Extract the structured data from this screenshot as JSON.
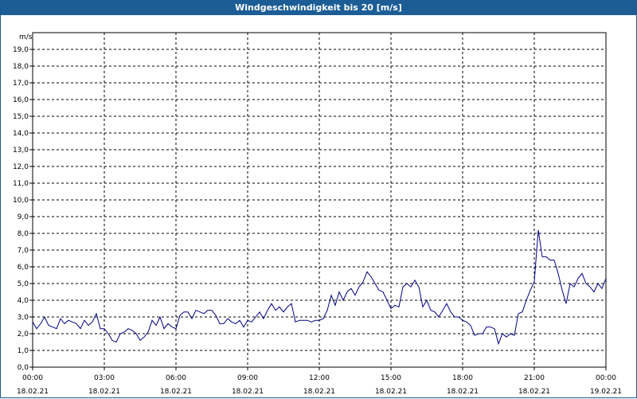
{
  "window": {
    "title": "Windgeschwindigkeit bis 20 [m/s]"
  },
  "chart_data": {
    "type": "line",
    "title": "Windgeschwindigkeit bis 20 [m/s]",
    "ylabel": "m/s",
    "ylim": [
      0,
      20
    ],
    "xlim": [
      "18.02.21 00:00",
      "19.02.21 00:00"
    ],
    "grid": true,
    "series_color": "#000080",
    "x_ticks": [
      {
        "time": "00:00",
        "date": "18.02.21"
      },
      {
        "time": "03:00",
        "date": "18.02.21"
      },
      {
        "time": "06:00",
        "date": "18.02.21"
      },
      {
        "time": "09:00",
        "date": "18.02.21"
      },
      {
        "time": "12:00",
        "date": "18.02.21"
      },
      {
        "time": "15:00",
        "date": "18.02.21"
      },
      {
        "time": "18:00",
        "date": "18.02.21"
      },
      {
        "time": "21:00",
        "date": "18.02.21"
      },
      {
        "time": "00:00",
        "date": "19.02.21"
      }
    ],
    "y_ticks": [
      "0,0",
      "1,0",
      "2,0",
      "3,0",
      "4,0",
      "5,0",
      "6,0",
      "7,0",
      "8,0",
      "9,0",
      "10,0",
      "11,0",
      "12,0",
      "13,0",
      "14,0",
      "15,0",
      "16,0",
      "17,0",
      "18,0",
      "19,0"
    ],
    "series": [
      {
        "x": [
          "00:00",
          "00:10",
          "00:20",
          "00:30",
          "00:40",
          "00:50",
          "01:00",
          "01:10",
          "01:20",
          "01:30",
          "01:40",
          "01:50",
          "02:00",
          "02:10",
          "02:20",
          "02:30",
          "02:40",
          "02:50",
          "03:00",
          "03:10",
          "03:20",
          "03:30",
          "03:40",
          "03:50",
          "04:00",
          "04:10",
          "04:20",
          "04:30",
          "04:40",
          "04:50",
          "05:00",
          "05:10",
          "05:20",
          "05:30",
          "05:40",
          "05:50",
          "06:00",
          "06:10",
          "06:20",
          "06:30",
          "06:40",
          "06:50",
          "07:00",
          "07:10",
          "07:20",
          "07:30",
          "07:40",
          "07:50",
          "08:00",
          "08:10",
          "08:20",
          "08:30",
          "08:40",
          "08:50",
          "09:00",
          "09:10",
          "09:20",
          "09:30",
          "09:40",
          "09:50",
          "10:00",
          "10:10",
          "10:20",
          "10:30",
          "10:40",
          "10:50",
          "11:00",
          "11:10",
          "11:20",
          "11:30",
          "11:40",
          "11:50",
          "12:00",
          "12:10",
          "12:20",
          "12:30",
          "12:40",
          "12:50",
          "13:00",
          "13:10",
          "13:20",
          "13:30",
          "13:40",
          "13:50",
          "14:00",
          "14:10",
          "14:20",
          "14:30",
          "14:40",
          "14:50",
          "15:00",
          "15:10",
          "15:20",
          "15:30",
          "15:40",
          "15:50",
          "16:00",
          "16:10",
          "16:20",
          "16:30",
          "16:40",
          "16:50",
          "17:00",
          "17:10",
          "17:20",
          "17:30",
          "17:40",
          "17:50",
          "18:00",
          "18:10",
          "18:20",
          "18:30",
          "18:40",
          "18:50",
          "19:00",
          "19:10",
          "19:20",
          "19:30",
          "19:40",
          "19:50",
          "20:00",
          "20:10",
          "20:20",
          "20:30",
          "20:40",
          "20:50",
          "21:00",
          "21:10",
          "21:20",
          "21:30",
          "21:40",
          "21:50",
          "22:00",
          "22:10",
          "22:20",
          "22:30",
          "22:40",
          "22:50",
          "23:00",
          "23:10",
          "23:20",
          "23:30",
          "23:40",
          "23:50",
          "24:00"
        ],
        "values": [
          2.7,
          2.3,
          2.6,
          3.0,
          2.5,
          2.4,
          2.3,
          2.9,
          2.6,
          2.8,
          2.7,
          2.6,
          2.3,
          2.8,
          2.5,
          2.7,
          3.2,
          2.3,
          2.3,
          2.0,
          1.6,
          1.5,
          2.0,
          2.1,
          2.3,
          2.2,
          2.0,
          1.6,
          1.8,
          2.1,
          2.8,
          2.5,
          3.0,
          2.3,
          2.6,
          2.4,
          2.3,
          3.1,
          3.3,
          3.3,
          2.9,
          3.4,
          3.3,
          3.2,
          3.4,
          3.4,
          3.1,
          2.6,
          2.6,
          2.9,
          2.7,
          2.6,
          2.8,
          2.4,
          2.8,
          2.7,
          3.0,
          3.3,
          2.9,
          3.4,
          3.8,
          3.4,
          3.6,
          3.3,
          3.6,
          3.8,
          2.7,
          2.8,
          2.8,
          2.8,
          2.7,
          2.8,
          2.8,
          2.9,
          3.4,
          4.3,
          3.7,
          4.5,
          4.0,
          4.5,
          4.7,
          4.3,
          4.8,
          5.1,
          5.7,
          5.4,
          5.0,
          4.6,
          4.5,
          4.0,
          3.5,
          3.7,
          3.6,
          4.8,
          5.0,
          4.8,
          5.2,
          4.8,
          3.6,
          4.0,
          3.4,
          3.3,
          3.0,
          3.4,
          3.8,
          3.3,
          3.0,
          3.0,
          2.8,
          2.7,
          2.5,
          1.9,
          2.0,
          2.0,
          2.4,
          2.4,
          2.3,
          1.4,
          2.0,
          1.8,
          2.0,
          1.9,
          3.2,
          3.3,
          4.0,
          4.6,
          5.1,
          8.2,
          6.6,
          6.6,
          6.4,
          6.4,
          5.6,
          4.6,
          3.8,
          5.0,
          4.8,
          5.3,
          5.6,
          5.0,
          4.8,
          4.5,
          5.0,
          4.7,
          5.3
        ]
      }
    ]
  }
}
